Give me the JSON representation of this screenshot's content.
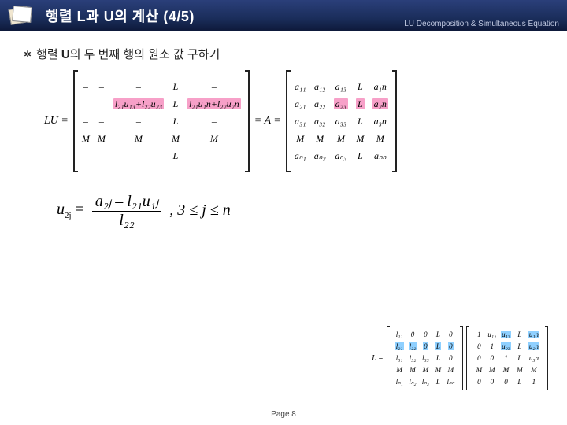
{
  "header": {
    "title_prefix": "행렬 ",
    "title_bold1": "L",
    "title_mid": "과 ",
    "title_bold2": "U",
    "title_suffix": "의 계산 (4/5)",
    "subtitle": "LU Decomposition & Simultaneous Equation"
  },
  "subhead": {
    "prefix": "행렬 ",
    "bold": "U",
    "suffix": "의 두 번째 행의 원소 값 구하기"
  },
  "lu_label": "LU =",
  "eqA_label": "= A =",
  "lu_matrix": {
    "rows": [
      [
        "–",
        "–",
        "–",
        "L",
        "–"
      ],
      [
        "–",
        "–",
        "HL:l₂₁u₁₃+l₂₂u₂₃",
        "L",
        "HL:l₂₁u₁n+l₂₂u₂n"
      ],
      [
        "–",
        "–",
        "–",
        "L",
        "–"
      ],
      [
        "M",
        "M",
        "M",
        "M",
        "M"
      ],
      [
        "–",
        "–",
        "–",
        "L",
        "–"
      ]
    ]
  },
  "a_matrix": {
    "rows": [
      [
        "a₁₁",
        "a₁₂",
        "a₁₃",
        "L",
        "a₁n"
      ],
      [
        "a₂₁",
        "a₂₂",
        "HL:a₂₃",
        "HL:L",
        "HL:a₂n"
      ],
      [
        "a₃₁",
        "a₃₂",
        "a₃₃",
        "L",
        "a₃n"
      ],
      [
        "M",
        "M",
        "M",
        "M",
        "M"
      ],
      [
        "aₙ₁",
        "aₙ₂",
        "aₙ₃",
        "L",
        "aₙₙ"
      ]
    ]
  },
  "formula": {
    "lhs": "u",
    "lhs_sub": "2j",
    "eq": " = ",
    "num": "a₂ⱼ – l₂₁u₁ⱼ",
    "den": "l₂₂",
    "cond": " ,  3 ≤ j ≤ n"
  },
  "small": {
    "L_label": "L =",
    "L_rows": [
      [
        "l₁₁",
        "0",
        "0",
        "L",
        "0"
      ],
      [
        "HB:l₂₁",
        "HB:l₂₂",
        "HB:0",
        "HB:L",
        "HB:0"
      ],
      [
        "l₃₁",
        "l₃₂",
        "l₃₃",
        "L",
        "0"
      ],
      [
        "M",
        "M",
        "M",
        "M",
        "M"
      ],
      [
        "lₙ₁",
        "lₙ₂",
        "lₙ₃",
        "L",
        "lₙₙ"
      ]
    ],
    "U_rows": [
      [
        "1",
        "u₁₂",
        "HB:u₁₃",
        "L",
        "HB:u₁n"
      ],
      [
        "0",
        "1",
        "HB:u₂₃",
        "L",
        "HB:u₂n"
      ],
      [
        "0",
        "0",
        "1",
        "L",
        "u₃n"
      ],
      [
        "M",
        "M",
        "M",
        "M",
        "M"
      ],
      [
        "0",
        "0",
        "0",
        "L",
        "1"
      ]
    ]
  },
  "pager": "Page 8",
  "chart_data": {
    "type": "table",
    "title": "LU Decomposition — computing row 2 of U",
    "formula": "u_{2j} = (a_{2j} - l_{21} u_{1j}) / l_{22}, 3 ≤ j ≤ n",
    "LU_product_highlight_row2": [
      "l21*u13 + l22*u23",
      "l21*u1n + l22*u2n"
    ],
    "A_highlight_row2": [
      "a23",
      "...",
      "a2n"
    ],
    "L_structure": "lower-triangular with diagonal l_ii, zeros above",
    "U_structure": "unit upper-triangular with 1 on diagonal, u_ij above",
    "page": 8
  }
}
